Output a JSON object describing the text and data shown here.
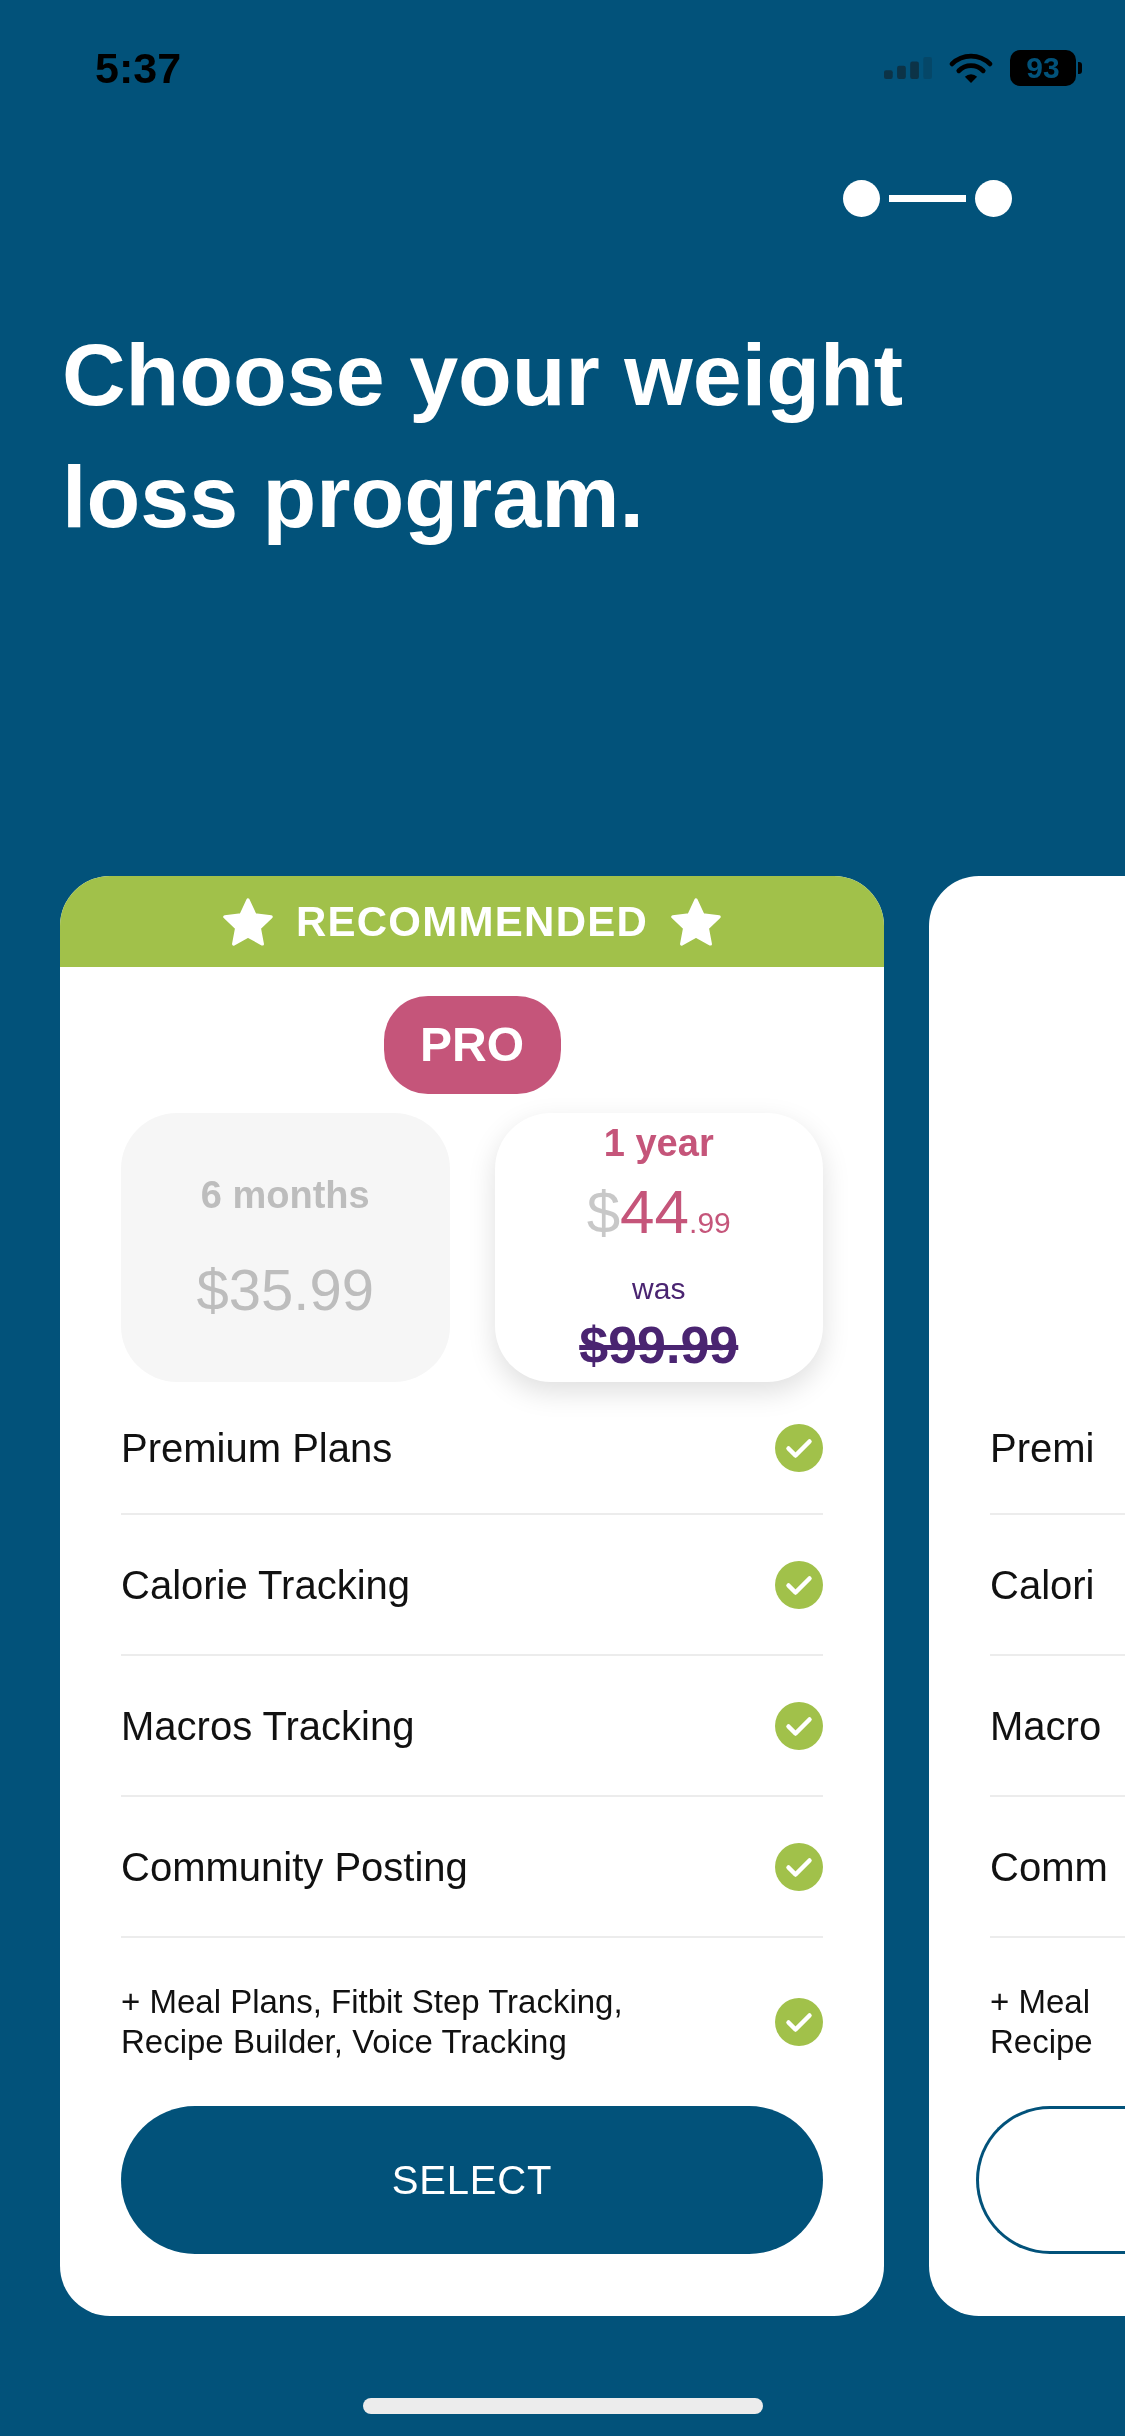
{
  "status_bar": {
    "time": "5:37",
    "battery": "93"
  },
  "heading": "Choose your weight loss program.",
  "cards": [
    {
      "banner": "RECOMMENDED",
      "badge": "PRO",
      "plans": [
        {
          "kind": "simple",
          "label": "6 months",
          "price": "$35.99",
          "selected": false
        },
        {
          "kind": "discounted",
          "label": "1 year",
          "currency": "$",
          "price_whole": "44",
          "price_cents": ".99",
          "was_label": "was",
          "old_price": "$99.99",
          "selected": true
        }
      ],
      "features": [
        {
          "kind": "standard",
          "label": "Premium Plans",
          "included": true
        },
        {
          "kind": "standard",
          "label": "Calorie Tracking",
          "included": true
        },
        {
          "kind": "standard",
          "label": "Macros Tracking",
          "included": true
        },
        {
          "kind": "standard",
          "label": "Community Posting",
          "included": true
        },
        {
          "kind": "extra",
          "label": "+ Meal Plans, Fitbit Step Tracking, Recipe Builder, Voice Tracking",
          "included": true
        }
      ],
      "button": {
        "kind": "filled",
        "label": "SELECT"
      }
    },
    {
      "features": [
        {
          "kind": "standard",
          "label": "Premi"
        },
        {
          "kind": "standard",
          "label": "Calori"
        },
        {
          "kind": "standard",
          "label": "Macro"
        },
        {
          "kind": "standard",
          "label": "Comm"
        },
        {
          "kind": "extra",
          "label": "+ Meal\nRecipe"
        }
      ],
      "button": {
        "kind": "outline"
      }
    }
  ]
}
